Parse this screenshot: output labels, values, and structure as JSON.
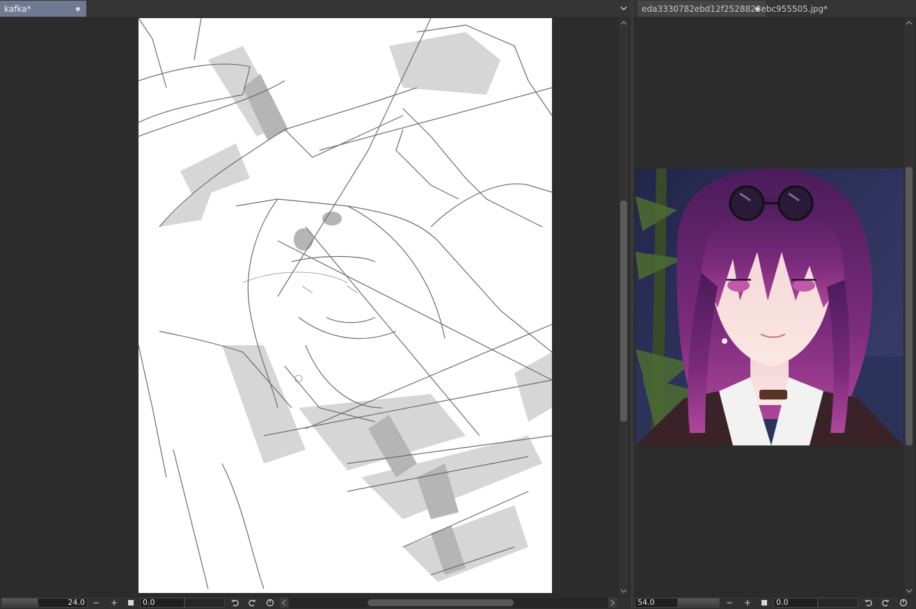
{
  "left_view": {
    "tab": {
      "title": "kafka*",
      "modified_icon": "dot-icon"
    },
    "status": {
      "zoom": "24.0",
      "zoom_out_label": "−",
      "zoom_in_label": "+",
      "rotation": "0.0"
    }
  },
  "right_view": {
    "tab": {
      "title": "eda3330782ebd12f2528828ebc955505.jpg*",
      "modified_icon": "dot-icon"
    },
    "status": {
      "zoom": "54.0",
      "zoom_out_label": "−",
      "zoom_in_label": "+",
      "rotation": "0.0"
    }
  },
  "colors": {
    "active_tab": "#6f7991",
    "inactive_tab": "#454545",
    "background": "#2c2c2c"
  }
}
